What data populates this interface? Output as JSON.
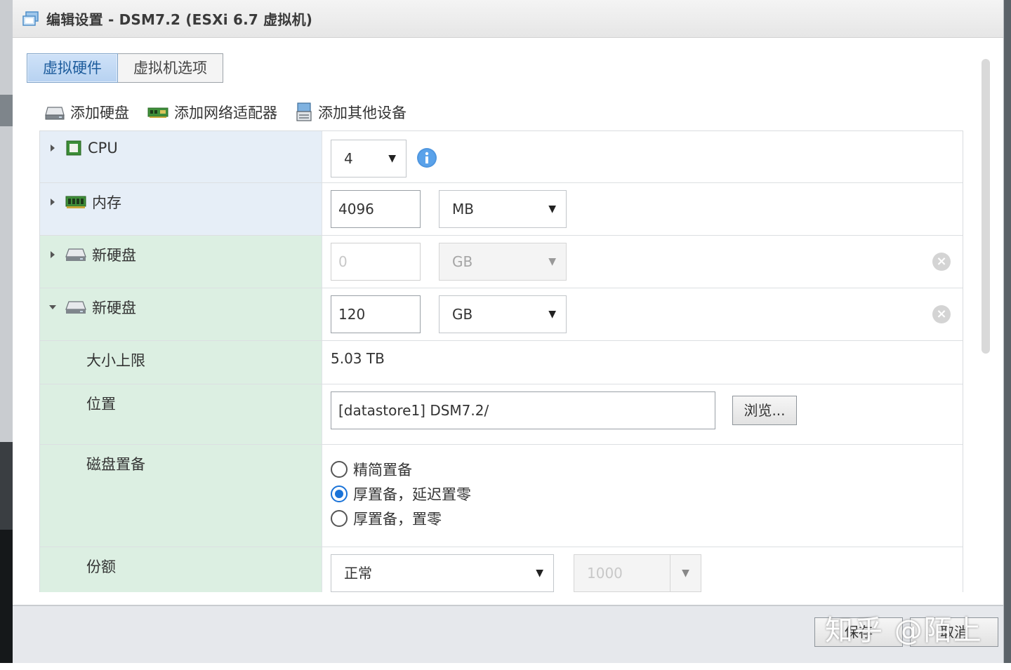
{
  "dialog": {
    "title": "编辑设置 - DSM7.2 (ESXi 6.7 虚拟机)"
  },
  "tabs": [
    {
      "label": "虚拟硬件",
      "active": true
    },
    {
      "label": "虚拟机选项",
      "active": false
    }
  ],
  "toolbar": {
    "add_disk": "添加硬盘",
    "add_network": "添加网络适配器",
    "add_other": "添加其他设备"
  },
  "cpu": {
    "label": "CPU",
    "value": "4"
  },
  "memory": {
    "label": "内存",
    "value": "4096",
    "unit": "MB"
  },
  "disk1": {
    "label": "新硬盘",
    "value": "0",
    "unit": "GB"
  },
  "disk2": {
    "label": "新硬盘",
    "value": "120",
    "unit": "GB",
    "max_size_label": "大小上限",
    "max_size_value": "5.03 TB",
    "location_label": "位置",
    "location_value": "[datastore1] DSM7.2/",
    "browse_label": "浏览...",
    "provisioning_label": "磁盘置备",
    "provisioning_options": [
      {
        "label": "精简置备",
        "selected": false
      },
      {
        "label": "厚置备，延迟置零",
        "selected": true
      },
      {
        "label": "厚置备，置零",
        "selected": false
      }
    ],
    "shares_label": "份额",
    "shares_value": "正常",
    "shares_number": "1000"
  },
  "footer": {
    "save_label": "保存",
    "cancel_label": "取消"
  },
  "watermark": "知乎 @陌上",
  "colors": {
    "accent": "#1a73d8",
    "blue_label_bg": "#e6eef7",
    "green_label_bg": "#dcefe2"
  }
}
